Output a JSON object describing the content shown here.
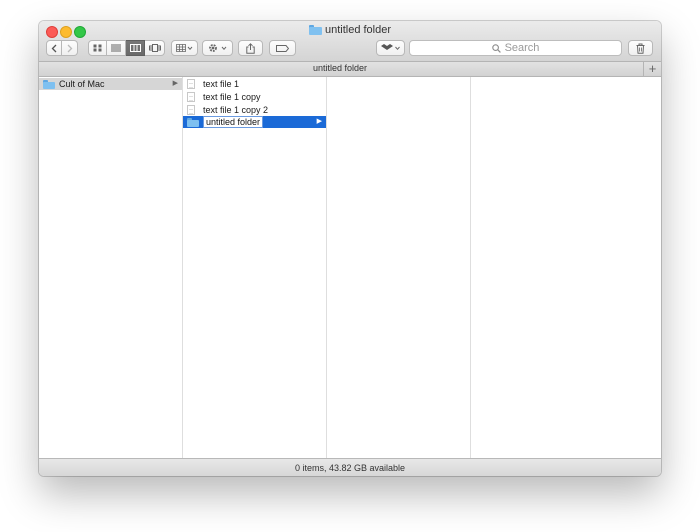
{
  "window": {
    "title": "untitled folder"
  },
  "toolbar": {
    "search_placeholder": "Search",
    "icons": {
      "back": "chevron-left-icon",
      "forward": "chevron-right-icon",
      "view_icons": "grid-icon",
      "view_list": "list-icon",
      "view_columns": "columns-icon",
      "view_coverflow": "coverflow-icon",
      "arrange": "arrange-grid-icon",
      "action": "gear-icon",
      "share": "share-icon",
      "tags": "tag-icon",
      "dropbox": "dropbox-icon",
      "trash": "trash-icon"
    },
    "active_view": "columns"
  },
  "pathbar": {
    "label": "untitled folder",
    "add_tab": "+"
  },
  "columns": [
    {
      "items": [
        {
          "name": "Cult of Mac",
          "kind": "folder",
          "selected": "inactive",
          "has_children": true
        }
      ]
    },
    {
      "items": [
        {
          "name": "text file 1",
          "kind": "file"
        },
        {
          "name": "text file 1 copy",
          "kind": "file"
        },
        {
          "name": "text file 1 copy 2",
          "kind": "file"
        },
        {
          "name": "untitled folder",
          "kind": "folder",
          "selected": "active",
          "editing": true,
          "has_children": true
        }
      ]
    },
    {
      "items": []
    },
    {
      "items": []
    }
  ],
  "status": {
    "text": "0 items, 43.82 GB available"
  },
  "colors": {
    "selection_blue": "#1b6ad7",
    "folder_blue": "#80c1f0",
    "close": "#fc5b57",
    "minimize": "#fdbb2e",
    "zoom": "#33c748"
  }
}
